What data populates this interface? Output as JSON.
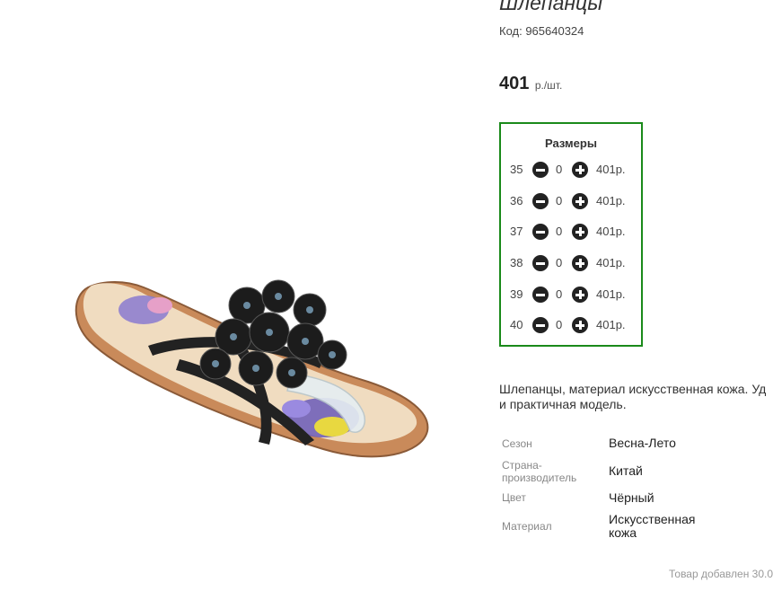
{
  "product": {
    "title": "Шлепанцы",
    "code": "Код: 965640324",
    "price": "401",
    "price_unit": "р./шт."
  },
  "sizes": {
    "title": "Размеры",
    "rows": [
      {
        "size": "35",
        "qty": "0",
        "price": "401р."
      },
      {
        "size": "36",
        "qty": "0",
        "price": "401р."
      },
      {
        "size": "37",
        "qty": "0",
        "price": "401р."
      },
      {
        "size": "38",
        "qty": "0",
        "price": "401р."
      },
      {
        "size": "39",
        "qty": "0",
        "price": "401р."
      },
      {
        "size": "40",
        "qty": "0",
        "price": "401р."
      }
    ]
  },
  "description": {
    "line1": "Шлепанцы, материал искусственная кожа. Уд",
    "line2": "и практичная модель."
  },
  "properties": [
    {
      "label": "Сезон",
      "value": "Весна-Лето"
    },
    {
      "label_line1": "Страна-",
      "label_line2": "производитель",
      "value": "Китай"
    },
    {
      "label": "Цвет",
      "value": "Чёрный"
    },
    {
      "label": "Материал",
      "value_line1": "Искусственная",
      "value_line2": "кожа"
    }
  ],
  "footer": {
    "added_note": "Товар добавлен 30.0"
  },
  "colors": {
    "sizes_border": "#1a8a1a",
    "button": "#222222"
  },
  "icons": {
    "decrease": "minus-circle-icon",
    "increase": "plus-circle-icon"
  }
}
